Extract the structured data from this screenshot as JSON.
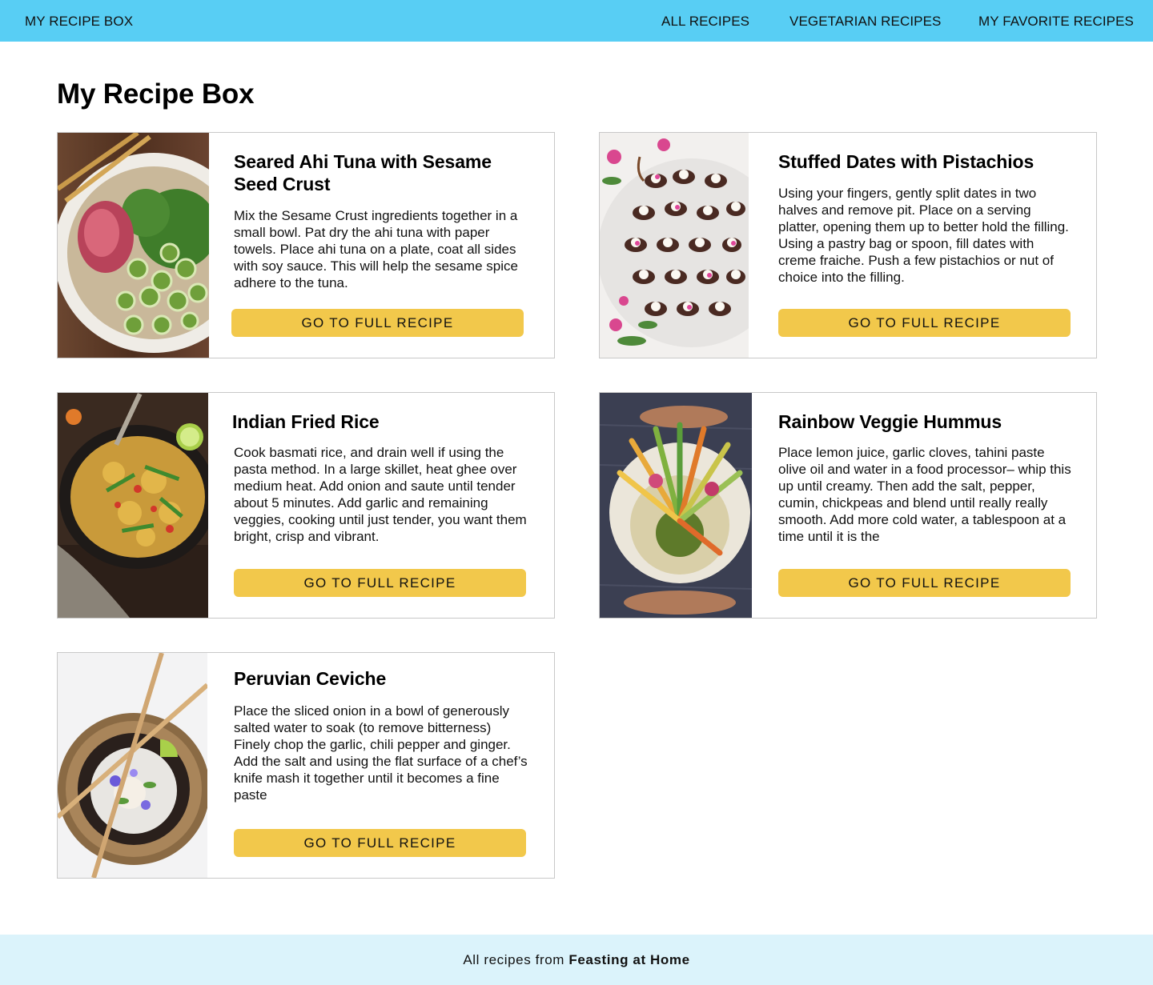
{
  "nav": {
    "brand": "MY RECIPE BOX",
    "links": [
      "ALL RECIPES",
      "VEGETARIAN RECIPES",
      "MY FAVORITE RECIPES"
    ]
  },
  "page": {
    "title": "My Recipe Box"
  },
  "recipes": [
    {
      "title": "Seared Ahi Tuna with Sesame Seed Crust",
      "description": "Mix the Sesame Crust ingredients together in a small bowl. Pat dry the ahi tuna with paper towels. Place ahi tuna on a plate, coat all sides with soy sauce. This will help the sesame spice adhere to the tuna.",
      "button": "GO TO FULL RECIPE",
      "image": "seared-ahi-tuna-bowl"
    },
    {
      "title": "Stuffed Dates with Pistachios",
      "description": "Using your fingers, gently split dates in two halves and remove pit. Place on a serving platter, opening them up to better hold the filling. Using a pastry bag or spoon, fill dates with creme fraiche. Push a few pistachios or nut of choice into the filling.",
      "button": "GO TO FULL RECIPE",
      "image": "stuffed-dates-platter"
    },
    {
      "title": "Indian Fried Rice",
      "description": "Cook basmati rice, and drain well if using the pasta method. In a large skillet, heat ghee over medium heat. Add onion and saute until tender about 5 minutes. Add garlic and remaining veggies, cooking until just tender, you want them bright, crisp and vibrant.",
      "button": "GO TO FULL RECIPE",
      "image": "indian-fried-rice-skillet"
    },
    {
      "title": "Rainbow Veggie Hummus",
      "description": "Place lemon juice, garlic cloves, tahini paste olive oil and water in a food processor– whip this up until creamy. Then add the salt, pepper, cumin, chickpeas and blend until really really smooth. Add more cold water, a tablespoon at a time until it is the",
      "button": "GO TO FULL RECIPE",
      "image": "rainbow-veggie-hummus-plate"
    },
    {
      "title": "Peruvian Ceviche",
      "description": "Place the sliced onion in a bowl of generously salted water to soak (to remove bitterness) Finely chop the garlic, chili pepper and ginger. Add the salt and using the flat surface of a chef’s knife mash it together until it becomes a fine paste",
      "button": "GO TO FULL RECIPE",
      "image": "peruvian-ceviche-bowl"
    }
  ],
  "footer": {
    "prefix": "All recipes from ",
    "source": "Feasting at Home"
  },
  "colors": {
    "navbar": "#58cef4",
    "button": "#f2c84b",
    "footer": "#dbf3fb"
  }
}
